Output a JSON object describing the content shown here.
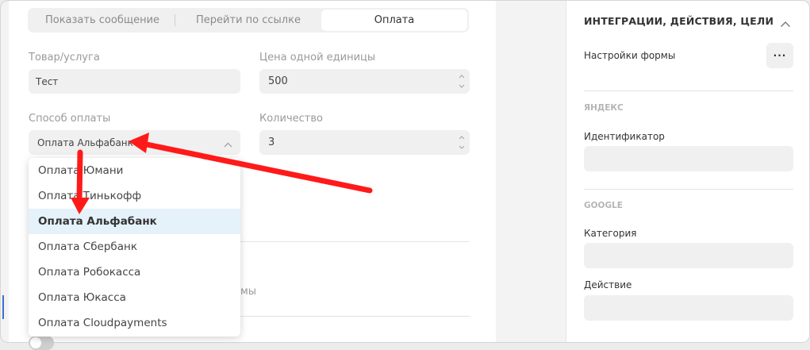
{
  "tabs": [
    {
      "label": "Показать сообщение",
      "active": false
    },
    {
      "label": "Перейти по ссылке",
      "active": false
    },
    {
      "label": "Оплата",
      "active": true
    }
  ],
  "form": {
    "product_label": "Товар/услуга",
    "product_value": "Тест",
    "price_label": "Цена одной единицы",
    "price_value": "500",
    "payment_method_label": "Способ оплаты",
    "payment_method_value": "Оплата Альфабанк",
    "quantity_label": "Количество",
    "quantity_value": "3",
    "partial_text": "мы"
  },
  "dropdown": {
    "options": [
      "Оплата Юмани",
      "Оплата Тинькофф",
      "Оплата Альфабанк",
      "Оплата Сбербанк",
      "Оплата Робокасса",
      "Оплата Юкасса",
      "Оплата Cloudpayments"
    ],
    "selected": "Оплата Альфабанк"
  },
  "right_panel": {
    "section_title": "ИНТЕГРАЦИИ, ДЕЙСТВИЯ, ЦЕЛИ",
    "form_settings_label": "Настройки формы",
    "more_button_label": "···",
    "yandex_caption": "ЯНДЕКС",
    "identifier_label": "Идентификатор",
    "google_caption": "GOOGLE",
    "category_label": "Категория",
    "action_label": "Действие"
  },
  "colors": {
    "annotation_arrow": "#ff1a1a",
    "selected_item_bg": "#e6f2fa",
    "field_bg": "#f0f0f0"
  }
}
